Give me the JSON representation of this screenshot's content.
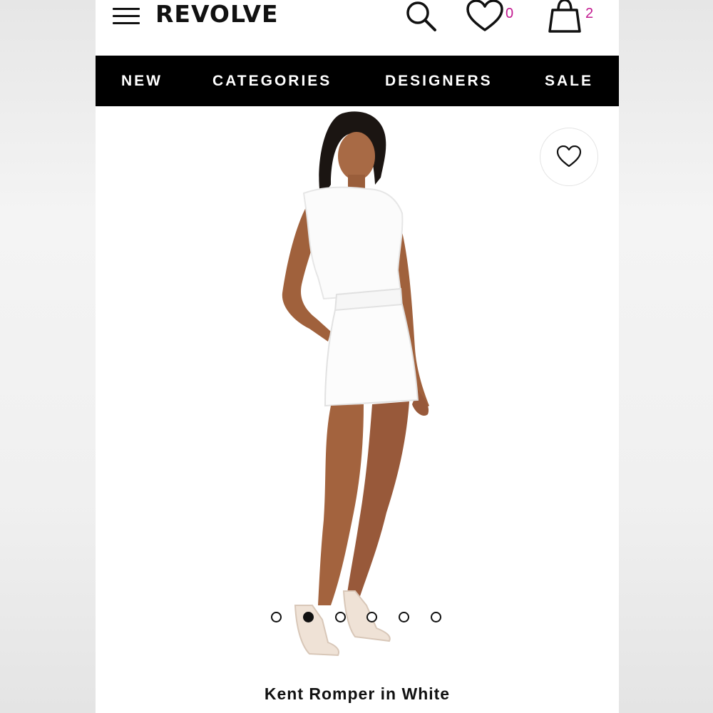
{
  "header": {
    "logo": "REVOLVE",
    "wishlist_count": "0",
    "bag_count": "2",
    "accent_color": "#c2188f"
  },
  "nav": {
    "items": [
      {
        "label": "NEW"
      },
      {
        "label": "CATEGORIES"
      },
      {
        "label": "DESIGNERS"
      },
      {
        "label": "SALE"
      }
    ]
  },
  "gallery": {
    "image_count": 6,
    "active_index": 1
  },
  "product": {
    "title": "Kent Romper in White"
  },
  "icons": [
    "menu-icon",
    "search-icon",
    "heart-icon",
    "bag-icon",
    "heart-outline-icon"
  ]
}
